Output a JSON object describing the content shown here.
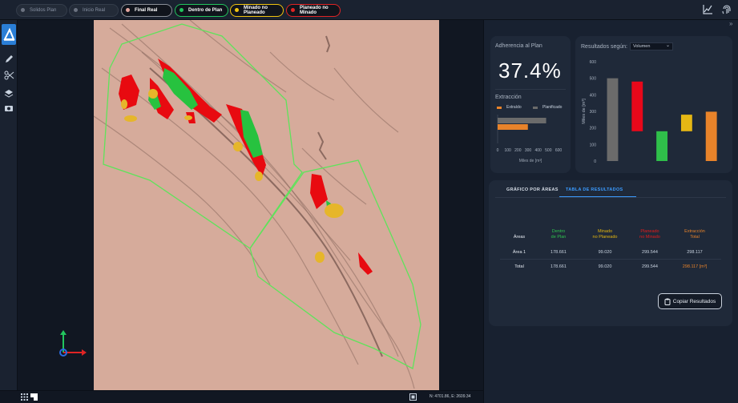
{
  "toolbar": {
    "pills": [
      {
        "label": "Solidos Plan",
        "dot": "#6b7280",
        "active": false
      },
      {
        "label": "Inicio Real",
        "dot": "#6b7280",
        "active": false
      },
      {
        "label": "Final Real",
        "dot": "#e5a7a0",
        "active": true
      },
      {
        "label": "Dentro de Plan",
        "dot": "#22c55e",
        "active": true
      },
      {
        "label": "Minado no Planeado",
        "dot": "#f1c40f",
        "active": true
      },
      {
        "label": "Planeado no Minado",
        "dot": "#e02424",
        "active": true
      }
    ]
  },
  "status": {
    "coords": "N: 4701.86, E: 2609.34"
  },
  "adherence": {
    "title": "Adherencia al Plan",
    "value": "37.4%"
  },
  "extraction": {
    "title": "Extracción",
    "legend": [
      {
        "label": "Extraído",
        "color": "#e8832a"
      },
      {
        "label": "Planificado",
        "color": "#6b6b6b"
      }
    ],
    "ticks": [
      "0",
      "100",
      "200",
      "300",
      "400",
      "500",
      "600"
    ],
    "xlabel": "Miles de [m³]"
  },
  "results": {
    "title": "Resultados según:",
    "select": "Volumen",
    "ylabel": "Miles de [m³]",
    "yticks": [
      "600",
      "500",
      "400",
      "300",
      "200",
      "100",
      "0"
    ]
  },
  "chart_data": [
    {
      "type": "bar",
      "title": "Extracción",
      "orientation": "horizontal",
      "series": [
        {
          "name": "Extraído",
          "values": [
            298.117
          ]
        },
        {
          "name": "Planificado",
          "values": [
            478.205
          ]
        }
      ],
      "xlim": [
        0,
        600
      ],
      "xlabel": "Miles de [m³]"
    },
    {
      "type": "bar",
      "title": "Resultados según: Volumen",
      "subtype": "waterfall",
      "categories": [
        "",
        "",
        "",
        "",
        ""
      ],
      "values": [
        {
          "start": 0,
          "end": 500,
          "color": "#6b6b6b"
        },
        {
          "start": 480,
          "end": 180,
          "color": "#e8081a"
        },
        {
          "start": 0,
          "end": 180,
          "color": "#2fbf4a"
        },
        {
          "start": 180,
          "end": 280,
          "color": "#e5b714"
        },
        {
          "start": 0,
          "end": 298,
          "color": "#e8832a"
        }
      ],
      "ylim": [
        0,
        600
      ],
      "ylabel": "Miles de [m³]"
    }
  ],
  "tabs": [
    {
      "label": "GRÁFICO POR ÁREAS",
      "active": false
    },
    {
      "label": "TABLA DE RESULTADOS",
      "active": true
    }
  ],
  "table": {
    "headers": [
      {
        "label": "Áreas",
        "color": "#e6ebf2"
      },
      {
        "label": "Dentro\nde Plan",
        "color": "#2fc24e"
      },
      {
        "label": "Minado\nno Planeado",
        "color": "#e3b60f"
      },
      {
        "label": "Planeado\nno Minado",
        "color": "#e51c1c"
      },
      {
        "label": "Extracción\nTotal",
        "color": "#e8832a"
      }
    ],
    "rows": [
      [
        "Área 1",
        "178.661",
        "99.020",
        "299.544",
        "298.117"
      ],
      [
        "Total",
        "178.661",
        "99.020",
        "299.544",
        "298.117 [m³]"
      ]
    ]
  },
  "copy_button": "Copiar Resultados"
}
